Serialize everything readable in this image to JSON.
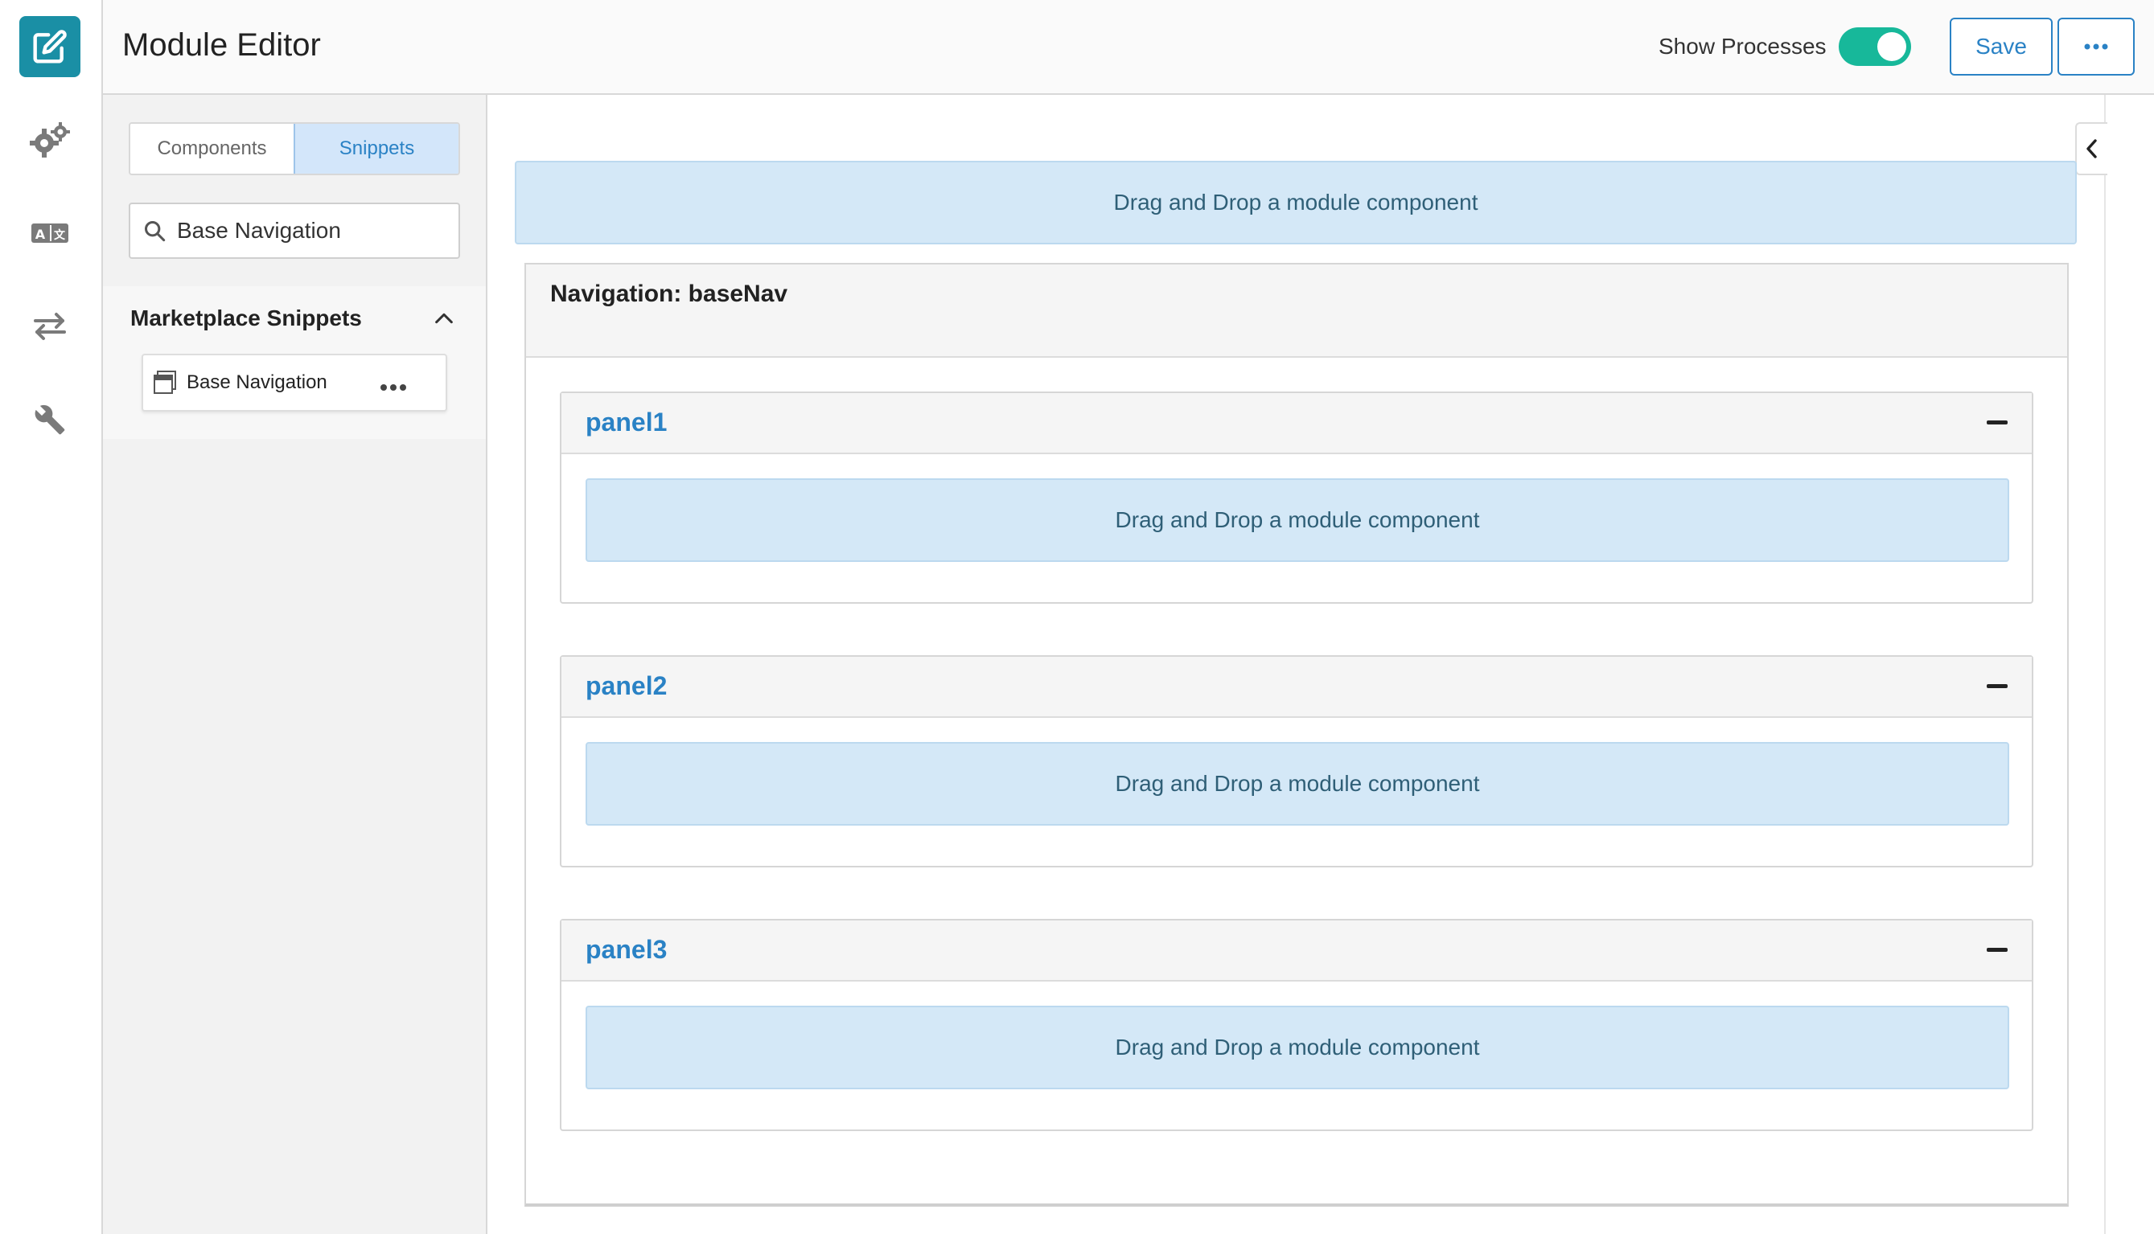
{
  "header": {
    "title": "Module Editor",
    "show_processes_label": "Show Processes",
    "show_processes_on": true,
    "save_label": "Save"
  },
  "rail": {
    "icons": [
      "edit-icon",
      "gears-icon",
      "translate-icon",
      "transfer-icon",
      "wrench-icon"
    ],
    "accent": "#1a8fa5"
  },
  "sidebar": {
    "tabs": [
      {
        "label": "Components",
        "active": false
      },
      {
        "label": "Snippets",
        "active": true
      }
    ],
    "search": {
      "value": "Base Navigation",
      "placeholder": ""
    },
    "section": {
      "title": "Marketplace Snippets",
      "expanded": true,
      "items": [
        {
          "label": "Base Navigation"
        }
      ]
    }
  },
  "canvas": {
    "top_dropzone": "Drag and Drop a module component",
    "navigation": {
      "title": "Navigation: baseNav",
      "panels": [
        {
          "title": "panel1",
          "dropzone": "Drag and Drop a module component"
        },
        {
          "title": "panel2",
          "dropzone": "Drag and Drop a module component"
        },
        {
          "title": "panel3",
          "dropzone": "Drag and Drop a module component"
        }
      ]
    }
  },
  "colors": {
    "toggle_on": "#17b89a",
    "primary": "#2a82c5",
    "dropzone": "#d4e8f7"
  }
}
